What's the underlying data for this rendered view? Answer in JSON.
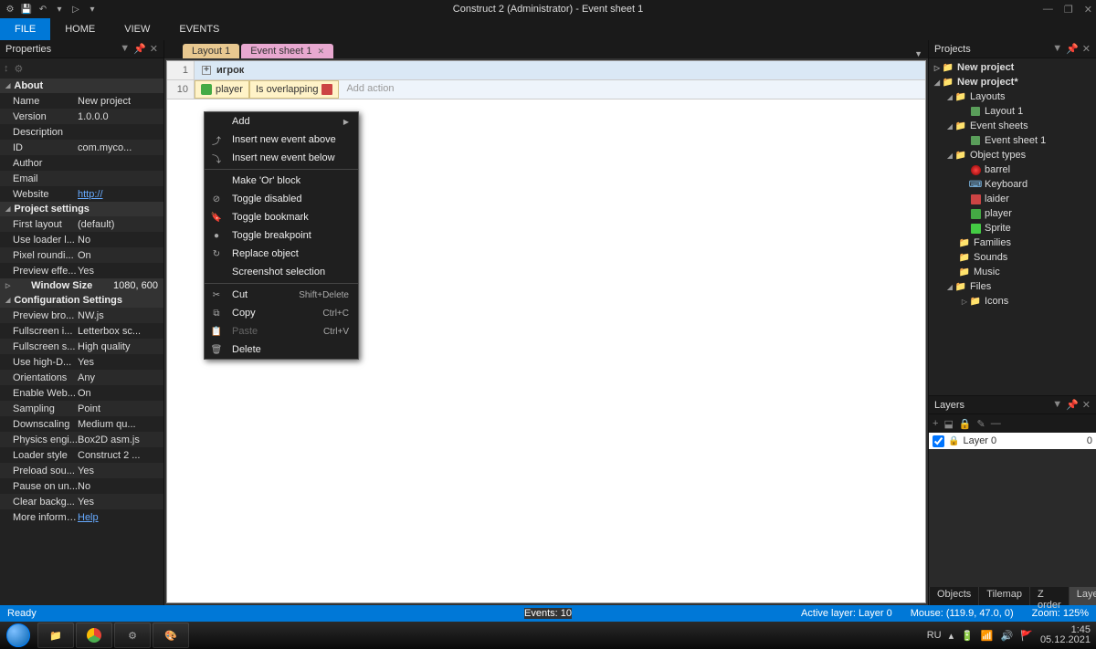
{
  "titlebar": {
    "title": "Construct 2 (Administrator) - Event sheet 1"
  },
  "menubar": {
    "file": "FILE",
    "home": "HOME",
    "view": "VIEW",
    "events": "EVENTS"
  },
  "panels": {
    "properties": {
      "title": "Properties"
    },
    "projects": {
      "title": "Projects"
    },
    "layers": {
      "title": "Layers"
    }
  },
  "props": {
    "about": {
      "header": "About",
      "name_k": "Name",
      "name_v": "New project",
      "version_k": "Version",
      "version_v": "1.0.0.0",
      "desc_k": "Description",
      "desc_v": "",
      "id_k": "ID",
      "id_v": "com.myco...",
      "author_k": "Author",
      "author_v": "",
      "email_k": "Email",
      "email_v": "",
      "website_k": "Website",
      "website_v": "http://"
    },
    "settings": {
      "header": "Project settings",
      "firstlayout_k": "First layout",
      "firstlayout_v": "(default)",
      "loader_k": "Use loader l...",
      "loader_v": "No",
      "pixelr_k": "Pixel roundi...",
      "pixelr_v": "On",
      "preview_k": "Preview effe...",
      "preview_v": "Yes"
    },
    "winsize": {
      "header": "Window Size",
      "header_v": "1080, 600"
    },
    "config": {
      "header": "Configuration Settings",
      "previewbro_k": "Preview bro...",
      "previewbro_v": "NW.js",
      "fsi_k": "Fullscreen i...",
      "fsi_v": "Letterbox sc...",
      "fss_k": "Fullscreen s...",
      "fss_v": "High quality",
      "hdpi_k": "Use high-D...",
      "hdpi_v": "Yes",
      "orient_k": "Orientations",
      "orient_v": "Any",
      "webgl_k": "Enable Web...",
      "webgl_v": "On",
      "sampling_k": "Sampling",
      "sampling_v": "Point",
      "downscale_k": "Downscaling",
      "downscale_v": "Medium qu...",
      "physics_k": "Physics engi...",
      "physics_v": "Box2D asm.js",
      "loaderstyle_k": "Loader style",
      "loaderstyle_v": "Construct 2 ...",
      "preload_k": "Preload sou...",
      "preload_v": "Yes",
      "pause_k": "Pause on un...",
      "pause_v": "No",
      "clearbg_k": "Clear backg...",
      "clearbg_v": "Yes",
      "moreinfo_k": "More informati...",
      "moreinfo_v": "Help"
    }
  },
  "tabs": {
    "layout": "Layout 1",
    "sheet": "Event sheet 1"
  },
  "events": {
    "row1_num": "1",
    "group_name": "игрок",
    "row2_num": "10",
    "cond_obj": "player",
    "cond_text": "Is overlapping",
    "add_action": "Add action"
  },
  "context": {
    "add": "Add",
    "insert_above": "Insert new event above",
    "insert_below": "Insert new event below",
    "make_or": "Make 'Or' block",
    "toggle_disabled": "Toggle disabled",
    "toggle_bookmark": "Toggle bookmark",
    "toggle_breakpoint": "Toggle breakpoint",
    "replace": "Replace object",
    "screenshot": "Screenshot selection",
    "cut": "Cut",
    "cut_sc": "Shift+Delete",
    "copy": "Copy",
    "copy_sc": "Ctrl+C",
    "paste": "Paste",
    "paste_sc": "Ctrl+V",
    "delete": "Delete"
  },
  "tree": {
    "proj1": "New project",
    "proj2": "New project*",
    "layouts": "Layouts",
    "layout1": "Layout 1",
    "sheets": "Event sheets",
    "sheet1": "Event sheet 1",
    "objtypes": "Object types",
    "barrel": "barrel",
    "keyboard": "Keyboard",
    "laider": "laider",
    "player": "player",
    "sprite": "Sprite",
    "families": "Families",
    "sounds": "Sounds",
    "music": "Music",
    "files": "Files",
    "icons": "Icons"
  },
  "layers": {
    "layer0": "Layer 0",
    "layer0_n": "0"
  },
  "bottom_tabs": {
    "objects": "Objects",
    "tilemap": "Tilemap",
    "zorder": "Z order",
    "layers": "Layers"
  },
  "status": {
    "ready": "Ready",
    "events": "Events: 10",
    "active_layer": "Active layer: Layer 0",
    "mouse": "Mouse: (119.9, 47.0, 0)",
    "zoom": "Zoom: 125%"
  },
  "tray": {
    "lang": "RU",
    "time": "1:45",
    "date": "05.12.2021"
  }
}
